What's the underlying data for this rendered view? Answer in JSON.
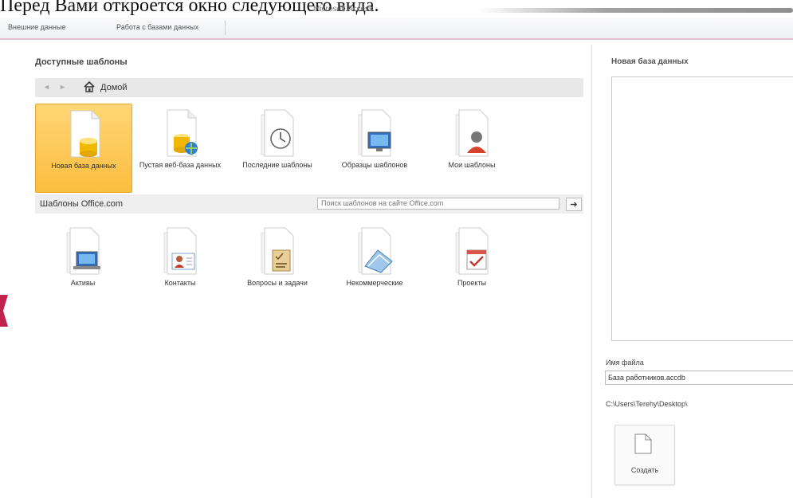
{
  "caption": "Перед Вами откроется окно следующего вида.",
  "app": {
    "title": "Microsoft Access"
  },
  "ribbon": {
    "tabs": [
      "Внешние данные",
      "Работа с базами данных"
    ]
  },
  "templates": {
    "title": "Доступные шаблоны",
    "nav": {
      "back": "◄",
      "forward": "►",
      "home_label": "Домой"
    },
    "items": [
      {
        "label": "Новая база данных",
        "icon": "new-database-icon",
        "selected": true
      },
      {
        "label": "Пустая веб-база данных",
        "icon": "web-database-icon"
      },
      {
        "label": "Последние шаблоны",
        "icon": "recent-templates-icon"
      },
      {
        "label": "Образцы шаблонов",
        "icon": "sample-templates-icon"
      },
      {
        "label": "Мои шаблоны",
        "icon": "my-templates-icon"
      }
    ],
    "office": {
      "label": "Шаблоны Office.com",
      "search_placeholder": "Поиск шаблонов на сайте Office.com",
      "go_label": "➔",
      "items": [
        {
          "label": "Активы",
          "icon": "assets-icon"
        },
        {
          "label": "Контакты",
          "icon": "contacts-icon"
        },
        {
          "label": "Вопросы и задачи",
          "icon": "issues-tasks-icon"
        },
        {
          "label": "Некоммерческие",
          "icon": "nonprofit-icon"
        },
        {
          "label": "Проекты",
          "icon": "projects-icon"
        }
      ]
    }
  },
  "new_db": {
    "title": "Новая база данных",
    "filename_label": "Имя файла",
    "filename_value": "База работников.accdb",
    "path": "C:\\Users\\Terehy\\Desktop\\",
    "create_label": "Создать"
  },
  "colors": {
    "selected_tile": "#fbc84f",
    "ribbon_border": "#e6c2d2",
    "accent_left": "#c0234e"
  }
}
